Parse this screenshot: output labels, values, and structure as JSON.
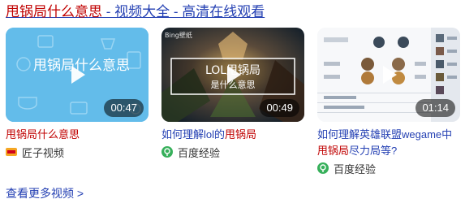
{
  "header": {
    "title_highlight": "甩锅局什么意思",
    "title_rest": " - 视频大全 - 高清在线观看"
  },
  "videos": [
    {
      "thumb_text": "甩锅局什么意思",
      "duration": "00:47",
      "title_highlight": "甩锅局什么意思",
      "source": "匠子视频",
      "source_icon": "jiangzi-logo-icon"
    },
    {
      "thumb_corner_text": "Bing壁纸",
      "thumb_overlay_line1": "LOL甩锅局",
      "thumb_overlay_line2": "是什么意思",
      "duration": "00:49",
      "title_pre": "如何理解lol的",
      "title_highlight": "甩锅局",
      "source": "百度经验",
      "source_icon": "baidu-jingyan-icon"
    },
    {
      "duration": "01:14",
      "title_pre": "如何理解英雄联盟wegame中",
      "title_highlight": "甩锅局",
      "title_post": "尽力局等?",
      "source": "百度经验",
      "source_icon": "baidu-jingyan-icon"
    }
  ],
  "more_link": "查看更多视频 >",
  "colors": {
    "link": "#2440b3",
    "highlight": "#c00000",
    "duration_bg": "rgba(0,0,0,0.55)",
    "jingyan_green": "#37b05b"
  }
}
